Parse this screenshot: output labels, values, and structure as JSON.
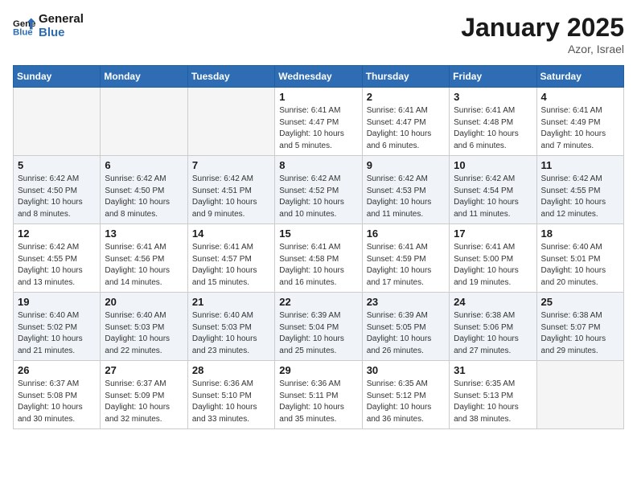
{
  "header": {
    "logo_line1": "General",
    "logo_line2": "Blue",
    "month_title": "January 2025",
    "location": "Azor, Israel"
  },
  "weekdays": [
    "Sunday",
    "Monday",
    "Tuesday",
    "Wednesday",
    "Thursday",
    "Friday",
    "Saturday"
  ],
  "weeks": [
    {
      "shade": false,
      "days": [
        {
          "num": "",
          "info": ""
        },
        {
          "num": "",
          "info": ""
        },
        {
          "num": "",
          "info": ""
        },
        {
          "num": "1",
          "info": "Sunrise: 6:41 AM\nSunset: 4:47 PM\nDaylight: 10 hours\nand 5 minutes."
        },
        {
          "num": "2",
          "info": "Sunrise: 6:41 AM\nSunset: 4:47 PM\nDaylight: 10 hours\nand 6 minutes."
        },
        {
          "num": "3",
          "info": "Sunrise: 6:41 AM\nSunset: 4:48 PM\nDaylight: 10 hours\nand 6 minutes."
        },
        {
          "num": "4",
          "info": "Sunrise: 6:41 AM\nSunset: 4:49 PM\nDaylight: 10 hours\nand 7 minutes."
        }
      ]
    },
    {
      "shade": true,
      "days": [
        {
          "num": "5",
          "info": "Sunrise: 6:42 AM\nSunset: 4:50 PM\nDaylight: 10 hours\nand 8 minutes."
        },
        {
          "num": "6",
          "info": "Sunrise: 6:42 AM\nSunset: 4:50 PM\nDaylight: 10 hours\nand 8 minutes."
        },
        {
          "num": "7",
          "info": "Sunrise: 6:42 AM\nSunset: 4:51 PM\nDaylight: 10 hours\nand 9 minutes."
        },
        {
          "num": "8",
          "info": "Sunrise: 6:42 AM\nSunset: 4:52 PM\nDaylight: 10 hours\nand 10 minutes."
        },
        {
          "num": "9",
          "info": "Sunrise: 6:42 AM\nSunset: 4:53 PM\nDaylight: 10 hours\nand 11 minutes."
        },
        {
          "num": "10",
          "info": "Sunrise: 6:42 AM\nSunset: 4:54 PM\nDaylight: 10 hours\nand 11 minutes."
        },
        {
          "num": "11",
          "info": "Sunrise: 6:42 AM\nSunset: 4:55 PM\nDaylight: 10 hours\nand 12 minutes."
        }
      ]
    },
    {
      "shade": false,
      "days": [
        {
          "num": "12",
          "info": "Sunrise: 6:42 AM\nSunset: 4:55 PM\nDaylight: 10 hours\nand 13 minutes."
        },
        {
          "num": "13",
          "info": "Sunrise: 6:41 AM\nSunset: 4:56 PM\nDaylight: 10 hours\nand 14 minutes."
        },
        {
          "num": "14",
          "info": "Sunrise: 6:41 AM\nSunset: 4:57 PM\nDaylight: 10 hours\nand 15 minutes."
        },
        {
          "num": "15",
          "info": "Sunrise: 6:41 AM\nSunset: 4:58 PM\nDaylight: 10 hours\nand 16 minutes."
        },
        {
          "num": "16",
          "info": "Sunrise: 6:41 AM\nSunset: 4:59 PM\nDaylight: 10 hours\nand 17 minutes."
        },
        {
          "num": "17",
          "info": "Sunrise: 6:41 AM\nSunset: 5:00 PM\nDaylight: 10 hours\nand 19 minutes."
        },
        {
          "num": "18",
          "info": "Sunrise: 6:40 AM\nSunset: 5:01 PM\nDaylight: 10 hours\nand 20 minutes."
        }
      ]
    },
    {
      "shade": true,
      "days": [
        {
          "num": "19",
          "info": "Sunrise: 6:40 AM\nSunset: 5:02 PM\nDaylight: 10 hours\nand 21 minutes."
        },
        {
          "num": "20",
          "info": "Sunrise: 6:40 AM\nSunset: 5:03 PM\nDaylight: 10 hours\nand 22 minutes."
        },
        {
          "num": "21",
          "info": "Sunrise: 6:40 AM\nSunset: 5:03 PM\nDaylight: 10 hours\nand 23 minutes."
        },
        {
          "num": "22",
          "info": "Sunrise: 6:39 AM\nSunset: 5:04 PM\nDaylight: 10 hours\nand 25 minutes."
        },
        {
          "num": "23",
          "info": "Sunrise: 6:39 AM\nSunset: 5:05 PM\nDaylight: 10 hours\nand 26 minutes."
        },
        {
          "num": "24",
          "info": "Sunrise: 6:38 AM\nSunset: 5:06 PM\nDaylight: 10 hours\nand 27 minutes."
        },
        {
          "num": "25",
          "info": "Sunrise: 6:38 AM\nSunset: 5:07 PM\nDaylight: 10 hours\nand 29 minutes."
        }
      ]
    },
    {
      "shade": false,
      "days": [
        {
          "num": "26",
          "info": "Sunrise: 6:37 AM\nSunset: 5:08 PM\nDaylight: 10 hours\nand 30 minutes."
        },
        {
          "num": "27",
          "info": "Sunrise: 6:37 AM\nSunset: 5:09 PM\nDaylight: 10 hours\nand 32 minutes."
        },
        {
          "num": "28",
          "info": "Sunrise: 6:36 AM\nSunset: 5:10 PM\nDaylight: 10 hours\nand 33 minutes."
        },
        {
          "num": "29",
          "info": "Sunrise: 6:36 AM\nSunset: 5:11 PM\nDaylight: 10 hours\nand 35 minutes."
        },
        {
          "num": "30",
          "info": "Sunrise: 6:35 AM\nSunset: 5:12 PM\nDaylight: 10 hours\nand 36 minutes."
        },
        {
          "num": "31",
          "info": "Sunrise: 6:35 AM\nSunset: 5:13 PM\nDaylight: 10 hours\nand 38 minutes."
        },
        {
          "num": "",
          "info": ""
        }
      ]
    }
  ]
}
